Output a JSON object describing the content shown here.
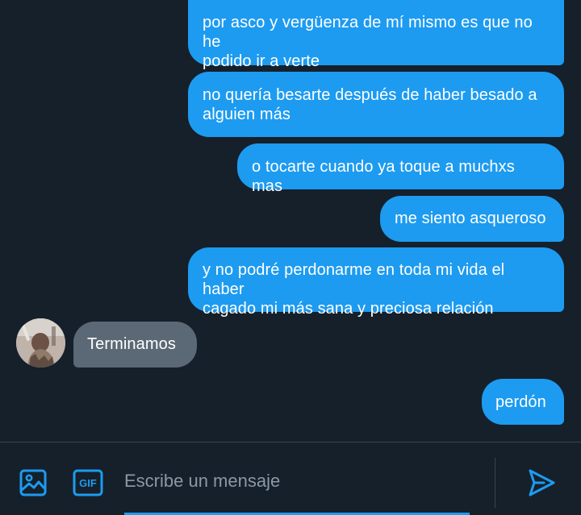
{
  "messages": [
    {
      "direction": "out",
      "text_lines": [
        "por asco y vergüenza de mí mismo es que no he",
        "podido ir a verte"
      ]
    },
    {
      "direction": "out",
      "text_lines": [
        "no quería besarte después de haber besado a",
        "alguien más"
      ]
    },
    {
      "direction": "out",
      "text_lines": [
        "o tocarte cuando ya toque a muchxs mas"
      ]
    },
    {
      "direction": "out",
      "text_lines": [
        "me siento asqueroso"
      ]
    },
    {
      "direction": "out",
      "text_lines": [
        "y no podré perdonarme en toda mi vida el haber",
        "cagado mi más sana y preciosa relación"
      ]
    },
    {
      "direction": "in",
      "text_lines": [
        "Terminamos"
      ]
    },
    {
      "direction": "out",
      "text_lines": [
        "perdón"
      ]
    }
  ],
  "composer": {
    "placeholder": "Escribe un mensaje",
    "media_icon": "image-icon",
    "gif_icon": "gif-icon",
    "gif_label": "GIF",
    "send_icon": "send-icon"
  },
  "colors": {
    "background": "#15202b",
    "outgoing_bubble": "#1d9bf0",
    "incoming_bubble": "#5b6875",
    "accent": "#1d9bf0"
  }
}
